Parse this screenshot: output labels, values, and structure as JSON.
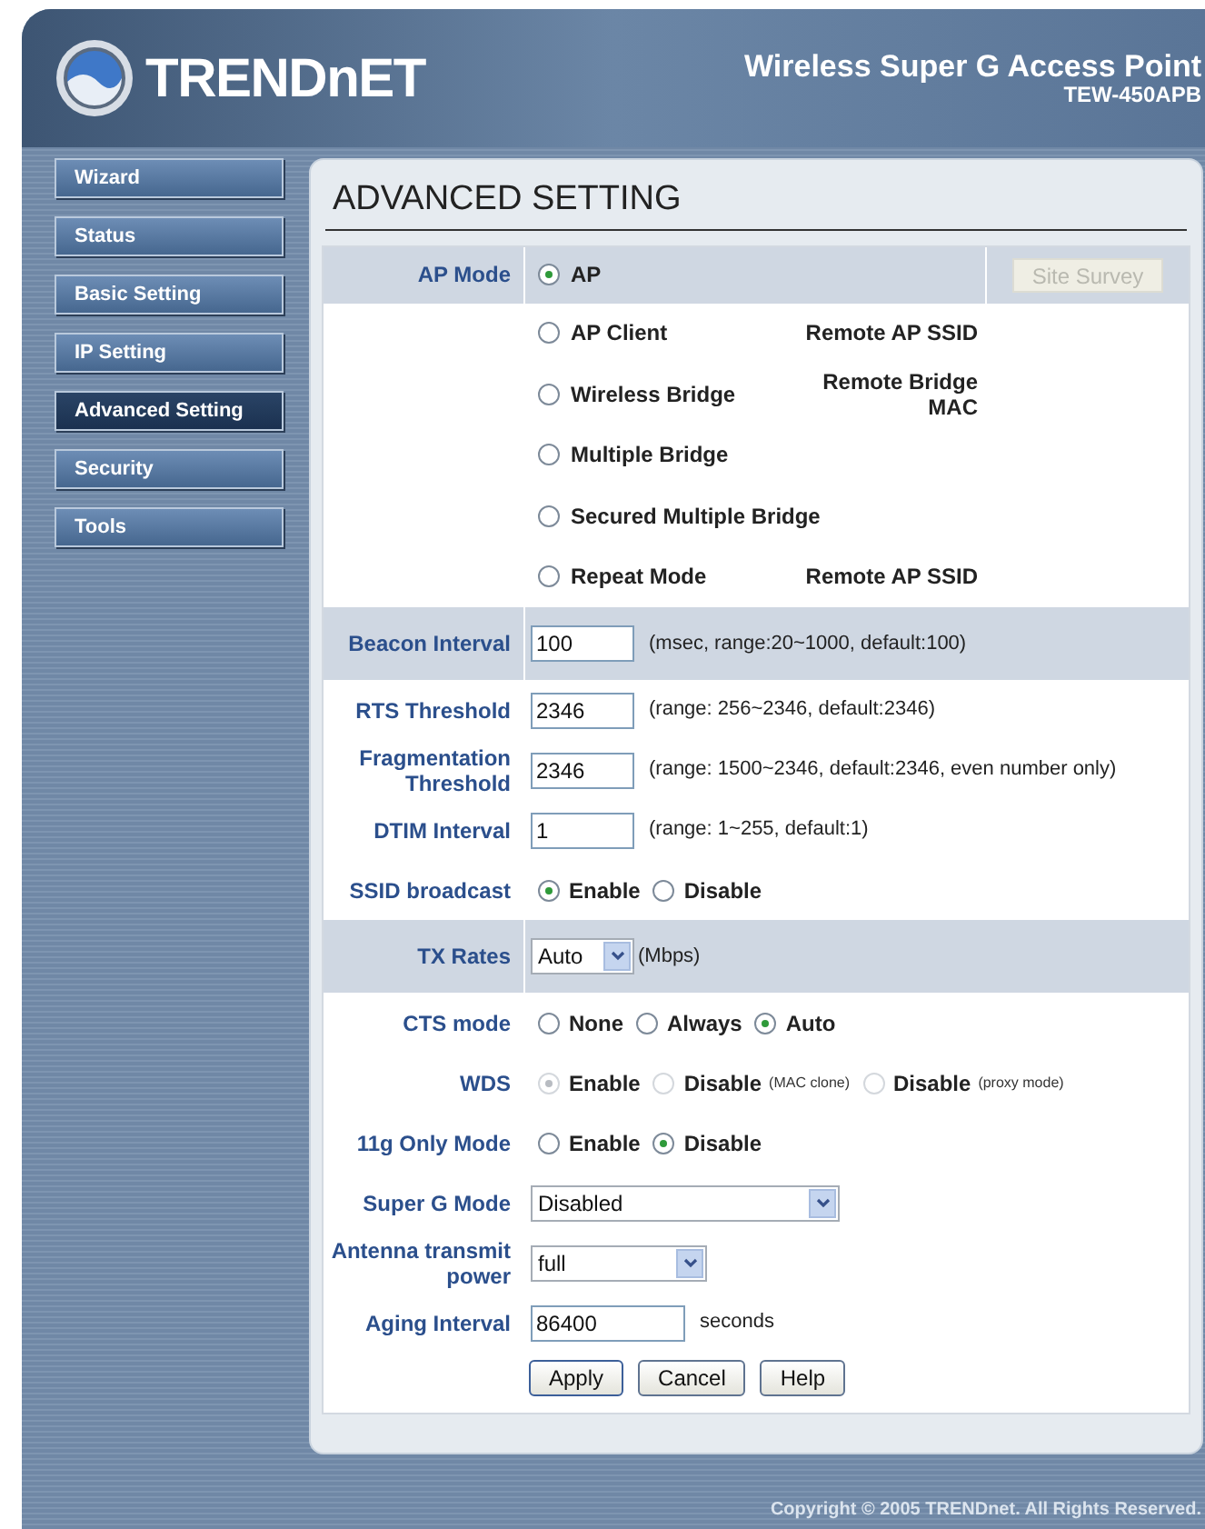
{
  "header": {
    "logo_text": "TRENDnET",
    "product": "Wireless Super G Access Point",
    "model": "TEW-450APB"
  },
  "sidebar": {
    "items": [
      {
        "label": "Wizard",
        "selected": false
      },
      {
        "label": "Status",
        "selected": false
      },
      {
        "label": "Basic Setting",
        "selected": false
      },
      {
        "label": "IP Setting",
        "selected": false
      },
      {
        "label": "Advanced Setting",
        "selected": true
      },
      {
        "label": "Security",
        "selected": false
      },
      {
        "label": "Tools",
        "selected": false
      }
    ]
  },
  "page_title": "ADVANCED SETTING",
  "rows": [
    {
      "kind": "mode",
      "label": "AP Mode",
      "shaded": true,
      "button": {
        "label": "Site Survey",
        "disabled": true
      },
      "options": [
        {
          "label": "AP",
          "selected": true
        },
        {
          "label": "AP Client",
          "selected": false,
          "note": "Remote AP SSID"
        },
        {
          "label": "Wireless Bridge",
          "selected": false,
          "note": "Remote Bridge MAC"
        },
        {
          "label": "Multiple Bridge",
          "selected": false
        },
        {
          "label": "Secured Multiple Bridge",
          "selected": false
        },
        {
          "label": "Repeat Mode",
          "selected": false,
          "note": "Remote AP SSID"
        }
      ]
    },
    {
      "kind": "text",
      "label": "Beacon Interval",
      "shaded": true,
      "value": "100",
      "hint": "(msec, range:20~1000, default:100)"
    },
    {
      "kind": "text",
      "label": "RTS Threshold",
      "shaded": false,
      "value": "2346",
      "hint": "(range: 256~2346, default:2346)"
    },
    {
      "kind": "text",
      "label": "Fragmentation Threshold",
      "shaded": false,
      "value": "2346",
      "hint": "(range: 1500~2346, default:2346, even number only)"
    },
    {
      "kind": "text",
      "label": "DTIM Interval",
      "shaded": false,
      "value": "1",
      "hint": "(range: 1~255, default:1)"
    },
    {
      "kind": "radio",
      "label": "SSID broadcast",
      "shaded": false,
      "disabled": false,
      "options": [
        {
          "label": "Enable",
          "selected": true
        },
        {
          "label": "Disable",
          "selected": false
        }
      ]
    },
    {
      "kind": "select",
      "label": "TX Rates",
      "shaded": true,
      "value": "Auto",
      "hint": "(Mbps)"
    },
    {
      "kind": "radio",
      "label": "CTS mode",
      "shaded": false,
      "disabled": false,
      "options": [
        {
          "label": "None",
          "selected": false
        },
        {
          "label": "Always",
          "selected": false
        },
        {
          "label": "Auto",
          "selected": true
        }
      ]
    },
    {
      "kind": "radio",
      "label": "WDS",
      "shaded": false,
      "disabled": true,
      "options": [
        {
          "label": "Enable",
          "selected": true
        },
        {
          "label": "Disable",
          "detail": "(MAC clone)",
          "selected": false
        },
        {
          "label": "Disable",
          "detail": "(proxy mode)",
          "selected": false
        }
      ]
    },
    {
      "kind": "radio",
      "label": "11g Only Mode",
      "shaded": false,
      "disabled": false,
      "options": [
        {
          "label": "Enable",
          "selected": false
        },
        {
          "label": "Disable",
          "selected": true
        }
      ]
    },
    {
      "kind": "select",
      "label": "Super G Mode",
      "shaded": false,
      "value": "Disabled"
    },
    {
      "kind": "select",
      "label": "Antenna transmit power",
      "shaded": false,
      "value": "full"
    },
    {
      "kind": "text",
      "label": "Aging Interval",
      "shaded": false,
      "value": "86400",
      "hint": "seconds"
    }
  ],
  "actions": [
    "Apply",
    "Cancel",
    "Help"
  ],
  "footer": "Copyright © 2005 TRENDnet. All Rights Reserved."
}
